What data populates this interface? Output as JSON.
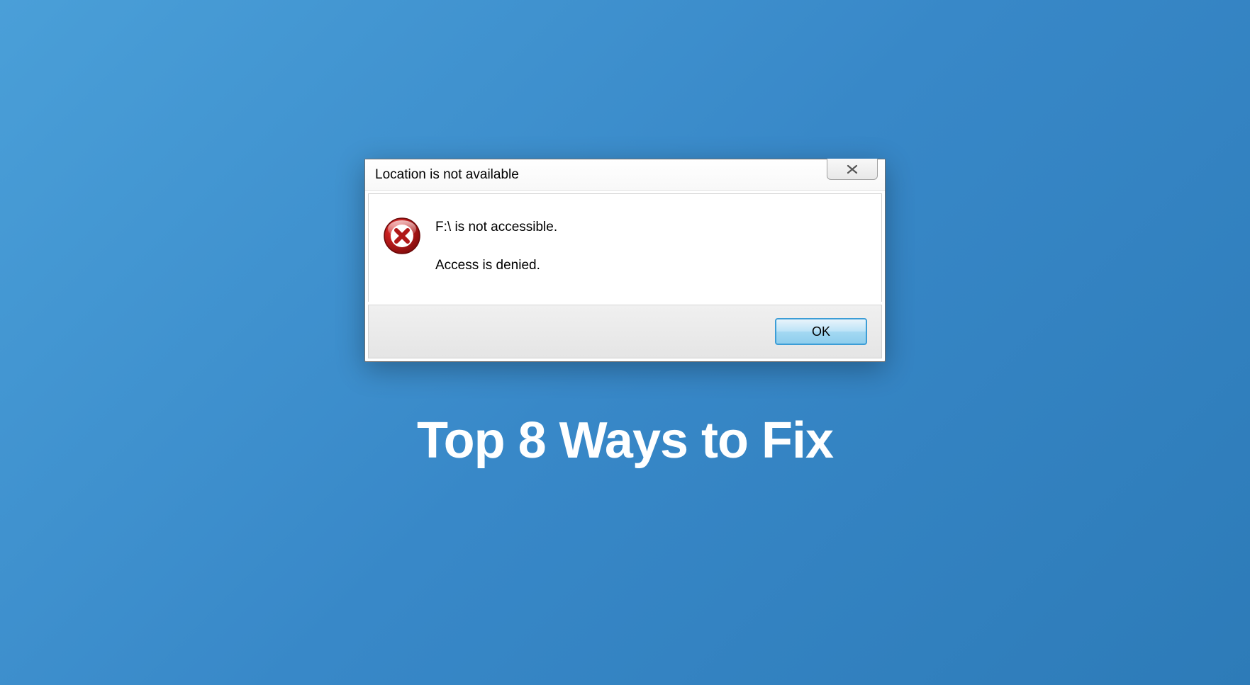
{
  "dialog": {
    "title": "Location is not available",
    "message_line1": "F:\\ is not accessible.",
    "message_line2": "Access is denied.",
    "ok_button": "OK"
  },
  "headline": "Top 8 Ways to Fix"
}
